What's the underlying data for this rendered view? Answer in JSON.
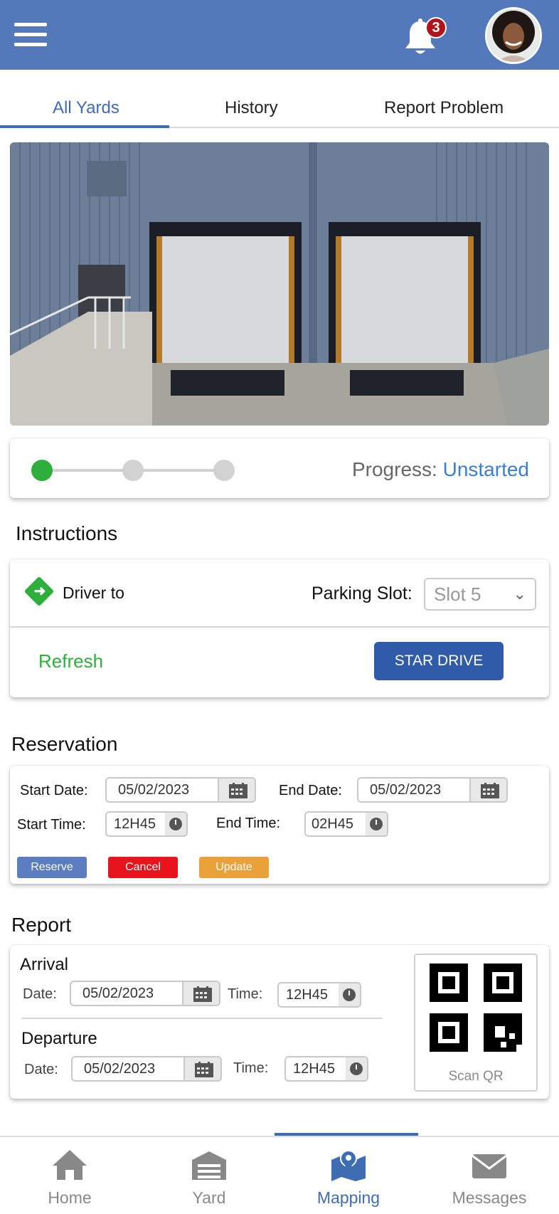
{
  "header": {
    "notification_count": "3"
  },
  "tabs": [
    {
      "label": "All Yards",
      "active": true
    },
    {
      "label": "History",
      "active": false
    },
    {
      "label": "Report Problem",
      "active": false
    }
  ],
  "progress": {
    "label": "Progress:",
    "status": "Unstarted",
    "steps_total": 3,
    "steps_completed": 1,
    "accent_color": "#2eae3c"
  },
  "instructions": {
    "title": "Instructions",
    "driver_label": "Driver to",
    "parking_label": "Parking Slot:",
    "slot_value": "Slot 5",
    "refresh_label": "Refresh",
    "start_button": "STAR DRIVE"
  },
  "reservation": {
    "title": "Reservation",
    "start_date_label": "Start Date:",
    "start_date": "05/02/2023",
    "end_date_label": "End Date:",
    "end_date": "05/02/2023",
    "start_time_label": "Start Time:",
    "start_time": "12H45",
    "end_time_label": "End Time:",
    "end_time": "02H45",
    "reserve_label": "Reserve",
    "cancel_label": "Cancel",
    "update_label": "Update",
    "colors": {
      "reserve": "#5a7dc0",
      "cancel": "#e8141b",
      "update": "#eaa13a"
    }
  },
  "report": {
    "title": "Report",
    "arrival": {
      "title": "Arrival",
      "date_label": "Date:",
      "date": "05/02/2023",
      "time_label": "Time:",
      "time": "12H45"
    },
    "departure": {
      "title": "Departure",
      "date_label": "Date:",
      "date": "05/02/2023",
      "time_label": "Time:",
      "time": "12H45"
    },
    "scan_label": "Scan QR"
  },
  "bottom_nav": [
    {
      "label": "Home",
      "icon": "home-icon",
      "active": false
    },
    {
      "label": "Yard",
      "icon": "warehouse-icon",
      "active": false
    },
    {
      "label": "Mapping",
      "icon": "map-pin-icon",
      "active": true
    },
    {
      "label": "Messages",
      "icon": "envelope-icon",
      "active": false
    }
  ]
}
